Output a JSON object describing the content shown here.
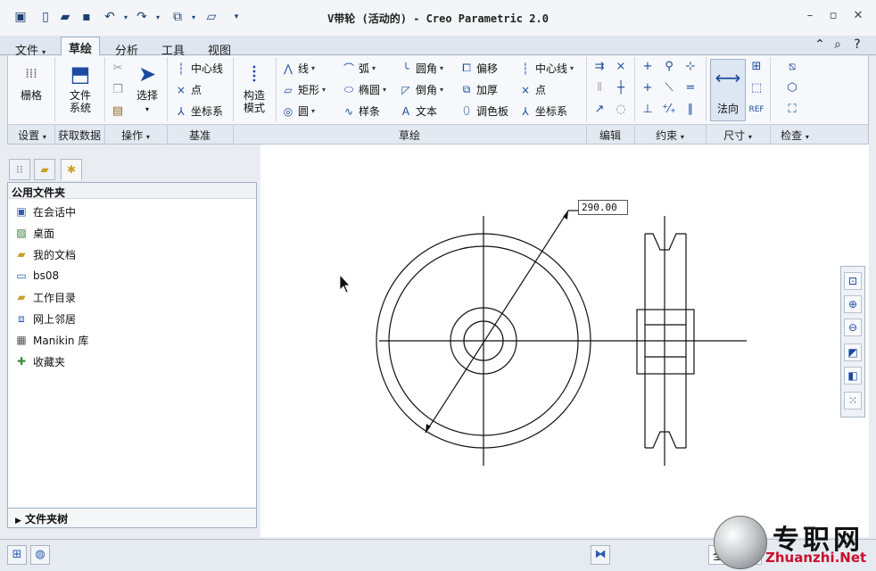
{
  "window": {
    "title": "V带轮 (活动的) - Creo Parametric 2.0"
  },
  "tabs": [
    {
      "label": "文件",
      "dropdown": true
    },
    {
      "label": "草绘"
    },
    {
      "label": "分析"
    },
    {
      "label": "工具"
    },
    {
      "label": "视图"
    }
  ],
  "ribbon": {
    "grid": "栅格",
    "file_system_1": "文件",
    "file_system_2": "系统",
    "select": "选择",
    "datum_centerline": "中心线",
    "datum_point": "点",
    "datum_csys": "坐标系",
    "construct_1": "构造",
    "construct_2": "模式",
    "line": "线",
    "rectangle": "矩形",
    "circle": "圆",
    "arc": "弧",
    "ellipse": "椭圆",
    "spline": "样条",
    "fillet": "圆角",
    "chamfer": "倒角",
    "text": "文本",
    "offset": "偏移",
    "thicken": "加厚",
    "palette": "调色板",
    "sk_centerline": "中心线",
    "sk_point": "点",
    "sk_csys": "坐标系",
    "normal": "法向"
  },
  "groups": {
    "settings": "设置",
    "get_data": "获取数据",
    "operations": "操作",
    "datum": "基准",
    "sketching": "草绘",
    "editing": "编辑",
    "constrain": "约束",
    "dimension": "尺寸",
    "inspect": "检查"
  },
  "navigator": {
    "header": "公用文件夹",
    "items": [
      {
        "label": "在会话中"
      },
      {
        "label": "桌面"
      },
      {
        "label": "我的文档"
      },
      {
        "label": "bs08"
      },
      {
        "label": "工作目录"
      },
      {
        "label": "网上邻居"
      },
      {
        "label": "Manikin 库"
      },
      {
        "label": "收藏夹"
      }
    ],
    "folder_tree": "文件夹树"
  },
  "graphics": {
    "dimension_value": "290.00"
  },
  "statusbar": {
    "filter": "全"
  },
  "watermark": {
    "cn": "专职网",
    "en": "Zhuanzhi.Net"
  },
  "colors": {
    "accent": "#1b4aa0",
    "sketch_line": "#111111",
    "watermark_red": "#c8102e"
  }
}
